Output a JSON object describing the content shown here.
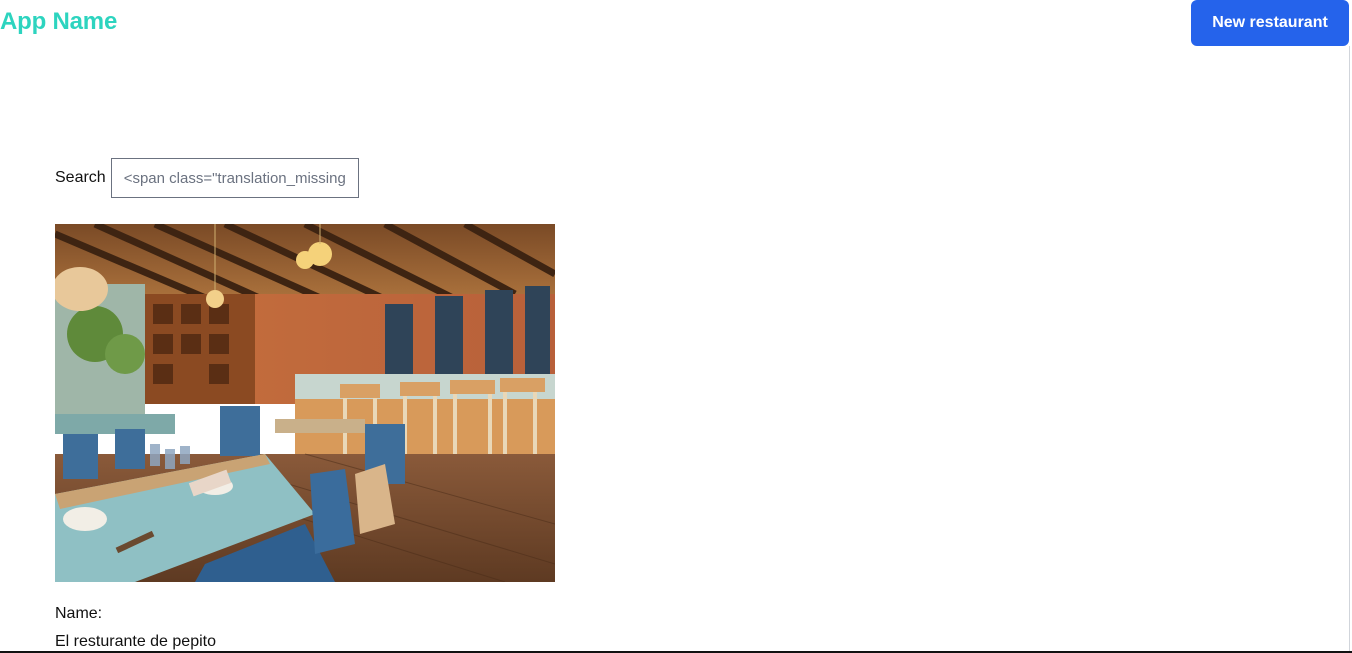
{
  "header": {
    "app_name": "App Name",
    "new_restaurant_label": "New restaurant"
  },
  "search": {
    "label": "Search",
    "value": "<span class=\"translation_missing\" title=\"translation missing: en.search\">Search</span>"
  },
  "restaurant": {
    "name_label": "Name:",
    "name_value": "El resturante de pepito",
    "photo_name": "restaurant-interior-photo"
  },
  "colors": {
    "brand": "#2dd4bf",
    "primary_button": "#2563eb"
  }
}
